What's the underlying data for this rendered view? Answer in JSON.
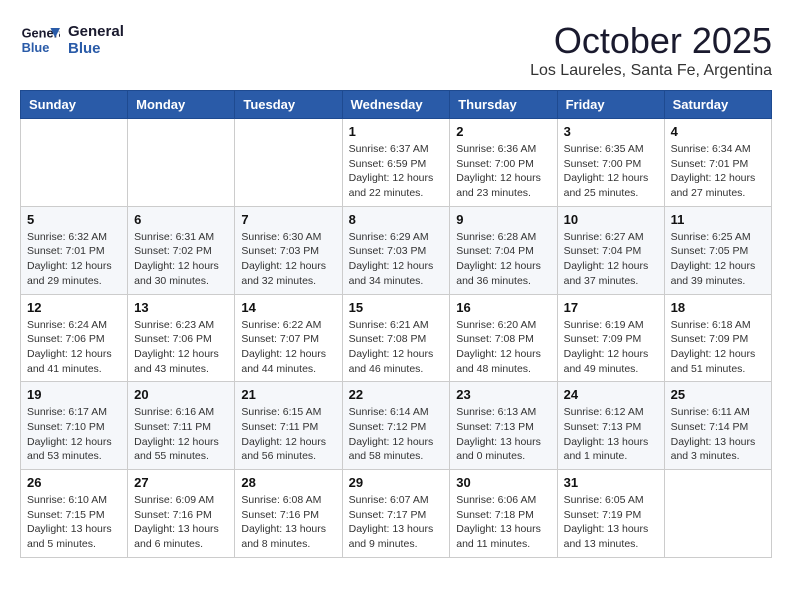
{
  "header": {
    "logo_line1": "General",
    "logo_line2": "Blue",
    "month": "October 2025",
    "location": "Los Laureles, Santa Fe, Argentina"
  },
  "weekdays": [
    "Sunday",
    "Monday",
    "Tuesday",
    "Wednesday",
    "Thursday",
    "Friday",
    "Saturday"
  ],
  "weeks": [
    [
      {
        "day": "",
        "info": ""
      },
      {
        "day": "",
        "info": ""
      },
      {
        "day": "",
        "info": ""
      },
      {
        "day": "1",
        "info": "Sunrise: 6:37 AM\nSunset: 6:59 PM\nDaylight: 12 hours\nand 22 minutes."
      },
      {
        "day": "2",
        "info": "Sunrise: 6:36 AM\nSunset: 7:00 PM\nDaylight: 12 hours\nand 23 minutes."
      },
      {
        "day": "3",
        "info": "Sunrise: 6:35 AM\nSunset: 7:00 PM\nDaylight: 12 hours\nand 25 minutes."
      },
      {
        "day": "4",
        "info": "Sunrise: 6:34 AM\nSunset: 7:01 PM\nDaylight: 12 hours\nand 27 minutes."
      }
    ],
    [
      {
        "day": "5",
        "info": "Sunrise: 6:32 AM\nSunset: 7:01 PM\nDaylight: 12 hours\nand 29 minutes."
      },
      {
        "day": "6",
        "info": "Sunrise: 6:31 AM\nSunset: 7:02 PM\nDaylight: 12 hours\nand 30 minutes."
      },
      {
        "day": "7",
        "info": "Sunrise: 6:30 AM\nSunset: 7:03 PM\nDaylight: 12 hours\nand 32 minutes."
      },
      {
        "day": "8",
        "info": "Sunrise: 6:29 AM\nSunset: 7:03 PM\nDaylight: 12 hours\nand 34 minutes."
      },
      {
        "day": "9",
        "info": "Sunrise: 6:28 AM\nSunset: 7:04 PM\nDaylight: 12 hours\nand 36 minutes."
      },
      {
        "day": "10",
        "info": "Sunrise: 6:27 AM\nSunset: 7:04 PM\nDaylight: 12 hours\nand 37 minutes."
      },
      {
        "day": "11",
        "info": "Sunrise: 6:25 AM\nSunset: 7:05 PM\nDaylight: 12 hours\nand 39 minutes."
      }
    ],
    [
      {
        "day": "12",
        "info": "Sunrise: 6:24 AM\nSunset: 7:06 PM\nDaylight: 12 hours\nand 41 minutes."
      },
      {
        "day": "13",
        "info": "Sunrise: 6:23 AM\nSunset: 7:06 PM\nDaylight: 12 hours\nand 43 minutes."
      },
      {
        "day": "14",
        "info": "Sunrise: 6:22 AM\nSunset: 7:07 PM\nDaylight: 12 hours\nand 44 minutes."
      },
      {
        "day": "15",
        "info": "Sunrise: 6:21 AM\nSunset: 7:08 PM\nDaylight: 12 hours\nand 46 minutes."
      },
      {
        "day": "16",
        "info": "Sunrise: 6:20 AM\nSunset: 7:08 PM\nDaylight: 12 hours\nand 48 minutes."
      },
      {
        "day": "17",
        "info": "Sunrise: 6:19 AM\nSunset: 7:09 PM\nDaylight: 12 hours\nand 49 minutes."
      },
      {
        "day": "18",
        "info": "Sunrise: 6:18 AM\nSunset: 7:09 PM\nDaylight: 12 hours\nand 51 minutes."
      }
    ],
    [
      {
        "day": "19",
        "info": "Sunrise: 6:17 AM\nSunset: 7:10 PM\nDaylight: 12 hours\nand 53 minutes."
      },
      {
        "day": "20",
        "info": "Sunrise: 6:16 AM\nSunset: 7:11 PM\nDaylight: 12 hours\nand 55 minutes."
      },
      {
        "day": "21",
        "info": "Sunrise: 6:15 AM\nSunset: 7:11 PM\nDaylight: 12 hours\nand 56 minutes."
      },
      {
        "day": "22",
        "info": "Sunrise: 6:14 AM\nSunset: 7:12 PM\nDaylight: 12 hours\nand 58 minutes."
      },
      {
        "day": "23",
        "info": "Sunrise: 6:13 AM\nSunset: 7:13 PM\nDaylight: 13 hours\nand 0 minutes."
      },
      {
        "day": "24",
        "info": "Sunrise: 6:12 AM\nSunset: 7:13 PM\nDaylight: 13 hours\nand 1 minute."
      },
      {
        "day": "25",
        "info": "Sunrise: 6:11 AM\nSunset: 7:14 PM\nDaylight: 13 hours\nand 3 minutes."
      }
    ],
    [
      {
        "day": "26",
        "info": "Sunrise: 6:10 AM\nSunset: 7:15 PM\nDaylight: 13 hours\nand 5 minutes."
      },
      {
        "day": "27",
        "info": "Sunrise: 6:09 AM\nSunset: 7:16 PM\nDaylight: 13 hours\nand 6 minutes."
      },
      {
        "day": "28",
        "info": "Sunrise: 6:08 AM\nSunset: 7:16 PM\nDaylight: 13 hours\nand 8 minutes."
      },
      {
        "day": "29",
        "info": "Sunrise: 6:07 AM\nSunset: 7:17 PM\nDaylight: 13 hours\nand 9 minutes."
      },
      {
        "day": "30",
        "info": "Sunrise: 6:06 AM\nSunset: 7:18 PM\nDaylight: 13 hours\nand 11 minutes."
      },
      {
        "day": "31",
        "info": "Sunrise: 6:05 AM\nSunset: 7:19 PM\nDaylight: 13 hours\nand 13 minutes."
      },
      {
        "day": "",
        "info": ""
      }
    ]
  ]
}
